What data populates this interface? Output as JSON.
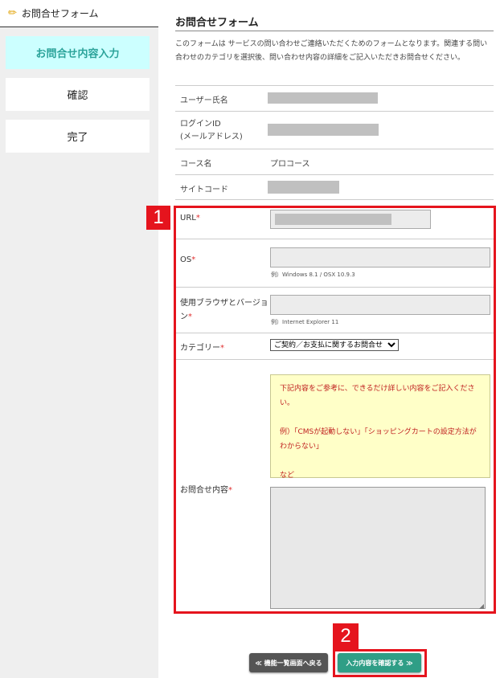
{
  "sidebar": {
    "title": "お問合せフォーム",
    "steps": [
      {
        "label": "お問合せ内容入力",
        "active": true
      },
      {
        "label": "確認"
      },
      {
        "label": "完了"
      }
    ]
  },
  "main": {
    "title": "お問合せフォーム",
    "description": "このフォームは サービスの問い合わせご連絡いただくためのフォームとなります。関連する問い合わせのカテゴリを選択後、問い合わせ内容の詳細をご記入いただきお問合せください。",
    "info_rows": [
      {
        "label": "ユーザー氏名",
        "value": ""
      },
      {
        "label": "ログインID\n(メールアドレス)",
        "value": ""
      },
      {
        "label": "コース名",
        "value": "プロコース"
      },
      {
        "label": "サイトコード",
        "value": ""
      }
    ],
    "form": {
      "url_label": "URL",
      "os_label": "OS",
      "os_hint": "例）Windows 8.1 / OSX 10.9.3",
      "browser_label": "使用ブラウザとバージョン",
      "browser_hint": "例）Internet Explorer 11",
      "category_label": "カテゴリー",
      "category_value": "ご契約／お支払に関するお問合せ",
      "inquiry_label": "お問合せ内容",
      "required_mark": "*",
      "note": [
        "下記内容をご参考に、できるだけ詳しい内容をご記入ください。",
        "",
        "例）「CMSが起動しない」「ショッピングカートの設定方法がわからない」",
        "",
        "など"
      ]
    },
    "buttons": {
      "back": "≪ 機能一覧画面へ戻る",
      "confirm": "入力内容を確認する ≫"
    }
  },
  "annotations": {
    "badge1": "1",
    "badge2": "2",
    "color": "#e5141d"
  }
}
